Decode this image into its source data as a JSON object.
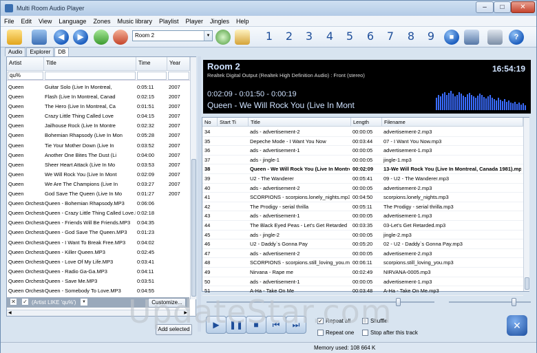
{
  "window": {
    "title": "Multi Room Audio Player"
  },
  "menu": [
    "File",
    "Edit",
    "View",
    "Language",
    "Zones",
    "Music library",
    "Playlist",
    "Player",
    "Jingles",
    "Help"
  ],
  "toolbar": {
    "room_select": "Room 2",
    "room_numbers": [
      "1",
      "2",
      "3",
      "4",
      "5",
      "6",
      "7",
      "8",
      "9"
    ]
  },
  "tabs": [
    "Audio",
    "Explorer",
    "DB"
  ],
  "library": {
    "columns": [
      "Artist",
      "Title",
      "Time",
      "Year"
    ],
    "filter_value": "qu%",
    "rows": [
      [
        "Queen",
        "Guitar Solo (Live In Montreal,",
        "0:05:11",
        "2007"
      ],
      [
        "Queen",
        "Flash (Live In Montreal, Canad",
        "0:02:15",
        "2007"
      ],
      [
        "Queen",
        "The Hero (Live In Montreal, Ca",
        "0:01:51",
        "2007"
      ],
      [
        "Queen",
        "Crazy Little Thing Called Love",
        "0:04:15",
        "2007"
      ],
      [
        "Queen",
        "Jailhouse Rock (Live In Montre",
        "0:02:32",
        "2007"
      ],
      [
        "Queen",
        "Bohemian Rhapsody (Live In Mon",
        "0:05:28",
        "2007"
      ],
      [
        "Queen",
        "Tie Your Mother Down (Live In",
        "0:03:52",
        "2007"
      ],
      [
        "Queen",
        "Another One Bites The Dust (Li",
        "0:04:00",
        "2007"
      ],
      [
        "Queen",
        "Sheer Heart Attack (Live In Mo",
        "0:03:53",
        "2007"
      ],
      [
        "Queen",
        "We Will Rock You (Live In Mont",
        "0:02:09",
        "2007"
      ],
      [
        "Queen",
        "We Are The Champions (Live In",
        "0:03:27",
        "2007"
      ],
      [
        "Queen",
        "God Save The Queen (Live In Mo",
        "0:01:27",
        "2007"
      ],
      [
        "Queen Orchestra",
        "Queen - Bohemian Rhapsody.MP3",
        "0:06:06",
        ""
      ],
      [
        "Queen Orchestra",
        "Queen - Crazy Little Thing Called Love.MP3",
        "0:02:18",
        ""
      ],
      [
        "Queen Orchestra",
        "Queen - Friends Will Be Friends.MP3",
        "0:04:35",
        ""
      ],
      [
        "Queen Orchestra",
        "Queen - God Save The Queen.MP3",
        "0:01:23",
        ""
      ],
      [
        "Queen Orchestra",
        "Queen - I Want To Break Free.MP3",
        "0:04:02",
        ""
      ],
      [
        "Queen Orchestra",
        "Queen - Killer Queen.MP3",
        "0:02:45",
        ""
      ],
      [
        "Queen Orchestra",
        "Queen - Love Of My Life.MP3",
        "0:03:41",
        ""
      ],
      [
        "Queen Orchestra",
        "Queen - Radio Ga-Ga.MP3",
        "0:04:11",
        ""
      ],
      [
        "Queen Orchestra",
        "Queen - Save Me.MP3",
        "0:03:51",
        ""
      ],
      [
        "Queen Orchestra",
        "Queen - Somebody To Love.MP3",
        "0:04:55",
        ""
      ]
    ],
    "filter_text": "(Artist LIKE 'qu%')",
    "customize_label": "Customize...",
    "add_selected_label": "Add selected"
  },
  "display": {
    "room": "Room 2",
    "device": "Realtek Digital Output (Realtek High Definition Audio) : Front (stereo)",
    "clock": "16:54:19",
    "times": "0:02:09 - 0:01:50 - 0:00:19",
    "track": "Queen - We Will Rock You (Live In Mont"
  },
  "playlist": {
    "columns": [
      "No",
      "Start Ti",
      "Title",
      "Length",
      "Filename"
    ],
    "current_index": 4,
    "rows": [
      [
        "34",
        "",
        "ads - advertisement-2",
        "00:00:05",
        "advertisement-2.mp3"
      ],
      [
        "35",
        "",
        "Depeche Mode - I Want You Now",
        "00:03:44",
        "07 - I Want You Now.mp3"
      ],
      [
        "36",
        "",
        "ads - advertisement-1",
        "00:00:05",
        "advertisement-1.mp3"
      ],
      [
        "37",
        "",
        "ads - jingle-1",
        "00:00:05",
        "jingle-1.mp3"
      ],
      [
        "38",
        "",
        "Queen - We Will Rock You (Live In Montreal, Canada 1981)",
        "00:02:09",
        "13-We Will Rock You (Live In Montreal, Canada 1981).mp3"
      ],
      [
        "39",
        "",
        "U2 - The Wanderer",
        "00:05:41",
        "09 - U2 - The Wanderer.mp3"
      ],
      [
        "40",
        "",
        "ads - advertisement-2",
        "00:00:05",
        "advertisement-2.mp3"
      ],
      [
        "41",
        "",
        "SCORPIONS - scorpions.lonely_nights.mp3",
        "00:04:50",
        "scorpions.lonely_nights.mp3"
      ],
      [
        "42",
        "",
        "The Prodigy - serial thrilla",
        "00:05:11",
        "The Prodigy - serial thrilla.mp3"
      ],
      [
        "43",
        "",
        "ads - advertisement-1",
        "00:00:05",
        "advertisement-1.mp3"
      ],
      [
        "44",
        "",
        "The Black Eyed Peas - Let's Get Retarded",
        "00:03:35",
        "03-Let's Get Retarded.mp3"
      ],
      [
        "45",
        "",
        "ads - jingle-2",
        "00:00:05",
        "jingle-2.mp3"
      ],
      [
        "46",
        "",
        "U2 - Daddy`s Gonna Pay",
        "00:05:20",
        "02 - U2 - Daddy`s Gonna Pay.mp3"
      ],
      [
        "47",
        "",
        "ads - advertisement-2",
        "00:00:05",
        "advertisement-2.mp3"
      ],
      [
        "48",
        "",
        "SCORPIONS - scorpions.still_loving_you.mp3",
        "00:06:11",
        "scorpions.still_loving_you.mp3"
      ],
      [
        "49",
        "",
        "Nirvana - Rape me",
        "00:02:49",
        "NIRVANA-0005.mp3"
      ],
      [
        "50",
        "",
        "ads - advertisement-1",
        "00:00:05",
        "advertisement-1.mp3"
      ],
      [
        "51",
        "",
        "A-Ha - Take On Me",
        "00:03:48",
        "A-Ha - Take On Me.mp3"
      ]
    ]
  },
  "player": {
    "repeat_all": "Repeat all",
    "repeat_all_checked": true,
    "shuffle": "Shuffle",
    "shuffle_checked": false,
    "repeat_one": "Repeat one",
    "repeat_one_checked": false,
    "stop_after": "Stop after this track",
    "stop_after_checked": false
  },
  "status": {
    "memory": "Memory used: 108 664 K"
  },
  "watermark": "UpdateStar.com",
  "colors": {
    "display_bg": "#000000",
    "spectrum": "#3a6cff",
    "accent": "#1e5fbf"
  }
}
